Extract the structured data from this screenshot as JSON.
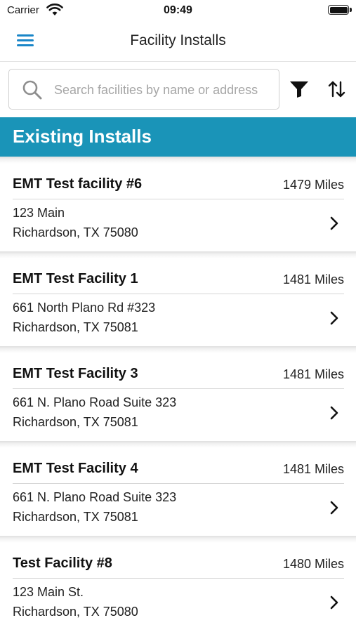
{
  "status_bar": {
    "carrier": "Carrier",
    "time": "09:49",
    "wifi_icon": "wifi-icon",
    "battery_icon": "battery-icon"
  },
  "nav": {
    "title": "Facility Installs",
    "menu_icon": "hamburger-menu-icon",
    "accent_color": "#1a86c8"
  },
  "search": {
    "placeholder": "Search facilities by name or address",
    "value": "",
    "filter_icon": "filter-icon",
    "sort_icon": "sort-icon"
  },
  "section": {
    "title": "Existing Installs",
    "background_color": "#1a94b8"
  },
  "facilities": [
    {
      "name": "EMT Test facility #6",
      "distance": "1479 Miles",
      "address_line1": "123 Main",
      "address_line2": "Richardson, TX 75080"
    },
    {
      "name": "EMT Test Facility 1",
      "distance": "1481 Miles",
      "address_line1": "661 North Plano Rd #323",
      "address_line2": "Richardson, TX 75081"
    },
    {
      "name": "EMT Test Facility 3",
      "distance": "1481 Miles",
      "address_line1": "661 N. Plano Road Suite 323",
      "address_line2": "Richardson, TX 75081"
    },
    {
      "name": "EMT Test Facility 4",
      "distance": "1481 Miles",
      "address_line1": "661 N. Plano Road Suite 323",
      "address_line2": "Richardson, TX 75081"
    },
    {
      "name": "Test Facility #8",
      "distance": "1480 Miles",
      "address_line1": "123 Main St.",
      "address_line2": "Richardson, TX 75080"
    }
  ]
}
